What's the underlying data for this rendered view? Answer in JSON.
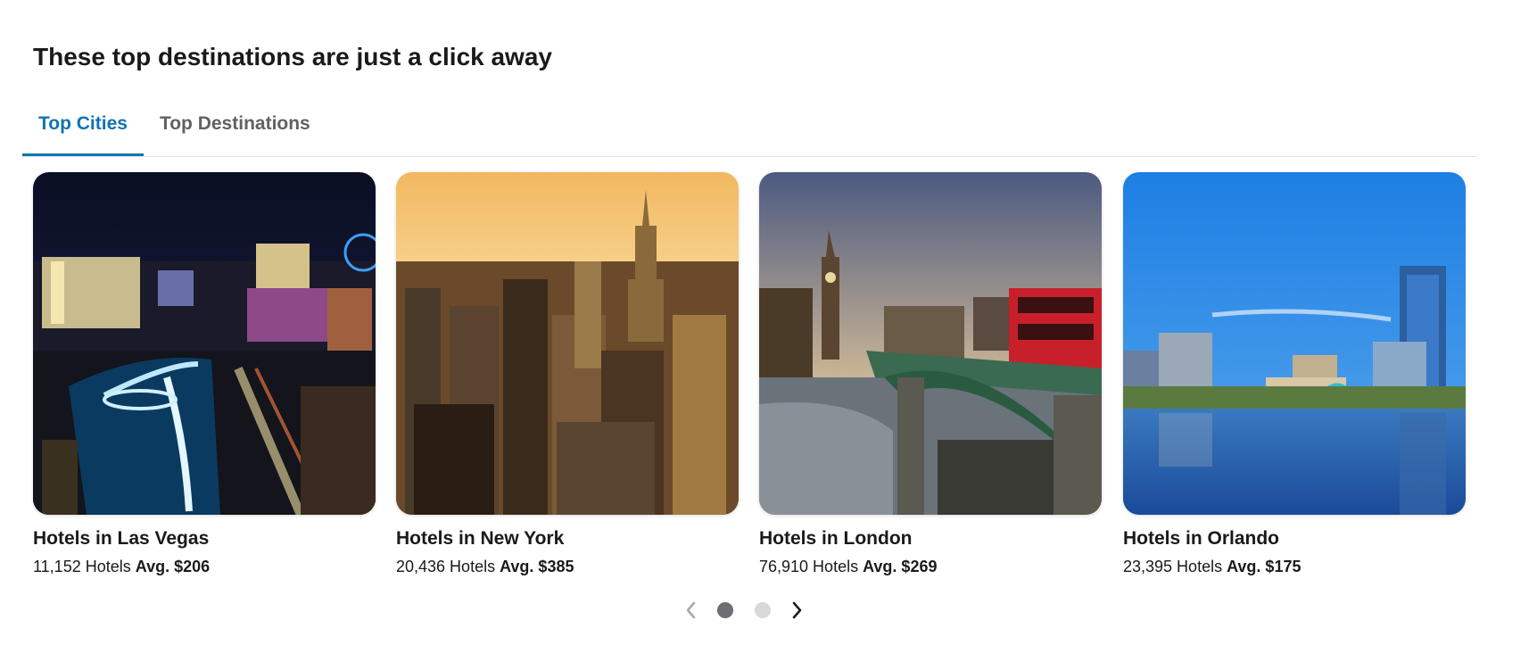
{
  "heading": "These top destinations are just a click away",
  "tabs": [
    {
      "label": "Top Cities",
      "active": true
    },
    {
      "label": "Top Destinations",
      "active": false
    }
  ],
  "cards": [
    {
      "title": "Hotels in Las Vegas",
      "count": "11,152 Hotels",
      "avg": "Avg. $206"
    },
    {
      "title": "Hotels in New York",
      "count": "20,436 Hotels",
      "avg": "Avg. $385"
    },
    {
      "title": "Hotels in London",
      "count": "76,910 Hotels",
      "avg": "Avg. $269"
    },
    {
      "title": "Hotels in Orlando",
      "count": "23,395 Hotels",
      "avg": "Avg. $175"
    }
  ],
  "pagination": {
    "pages": 2,
    "current": 1
  },
  "colors": {
    "accent": "#1173b2",
    "dot_active": "#6c6e74",
    "dot_inactive": "#d8d9dc"
  },
  "icons": {
    "prev": "chevron-left-icon",
    "next": "chevron-right-icon"
  }
}
